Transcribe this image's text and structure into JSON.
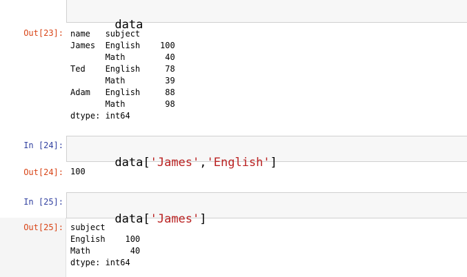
{
  "cells": [
    {
      "in_prompt": "",
      "code_tokens": [
        {
          "t": "data",
          "s": false
        }
      ],
      "out_prompt": "Out[23]:",
      "output": "name   subject\nJames  English    100\n       Math        40\nTed    English     78\n       Math        39\nAdam   English     88\n       Math        98\ndtype: int64"
    },
    {
      "in_prompt": "In [24]:",
      "code_tokens": [
        {
          "t": "data[",
          "s": false
        },
        {
          "t": "'James'",
          "s": true
        },
        {
          "t": ",",
          "s": false
        },
        {
          "t": "'English'",
          "s": true
        },
        {
          "t": "]",
          "s": false
        }
      ],
      "out_prompt": "Out[24]:",
      "output": "100"
    },
    {
      "in_prompt": "In [25]:",
      "code_tokens": [
        {
          "t": "data[",
          "s": false
        },
        {
          "t": "'James'",
          "s": true
        },
        {
          "t": "]",
          "s": false
        }
      ],
      "out_prompt": "Out[25]:",
      "output": "subject\nEnglish    100\nMath        40\ndtype: int64"
    }
  ]
}
